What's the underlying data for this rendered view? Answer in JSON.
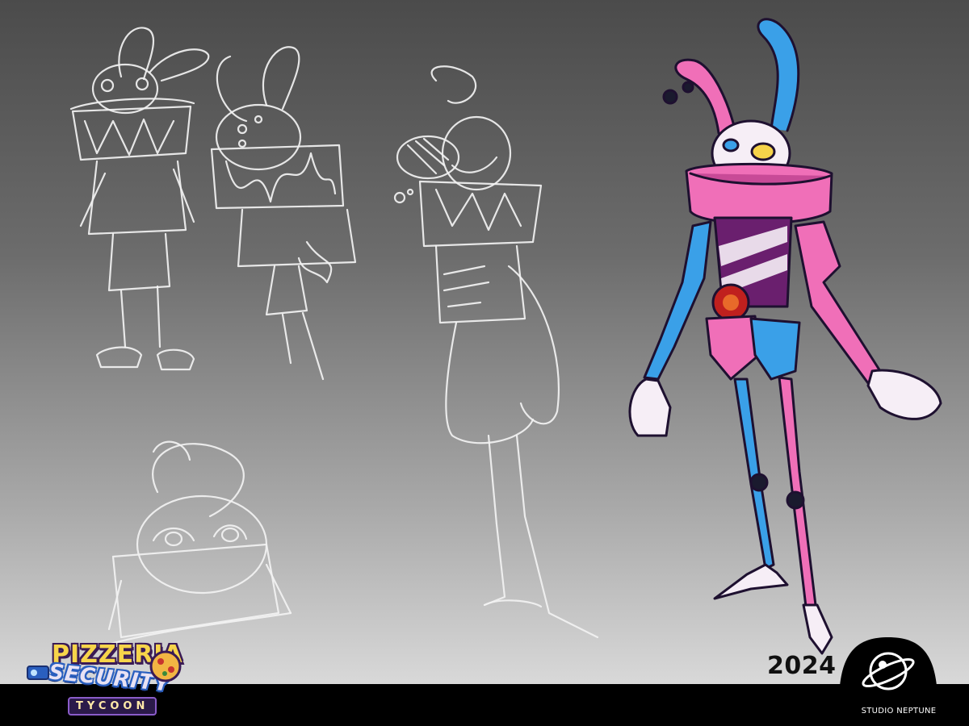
{
  "branding": {
    "game_logo": {
      "line1": "PIZZERIA",
      "line2": "SECURITY",
      "line3": "TYCOON"
    },
    "year": "2024",
    "studio_name": "STUDIO NEPTUNE"
  },
  "colors": {
    "pink": "#f06fb8",
    "blue": "#3aa0e8",
    "purple": "#6a1f6e",
    "white": "#f6eef6",
    "bar": "#000000"
  },
  "icons": [
    "studio-neptune-logo-icon",
    "pizza-icon",
    "camera-icon"
  ]
}
